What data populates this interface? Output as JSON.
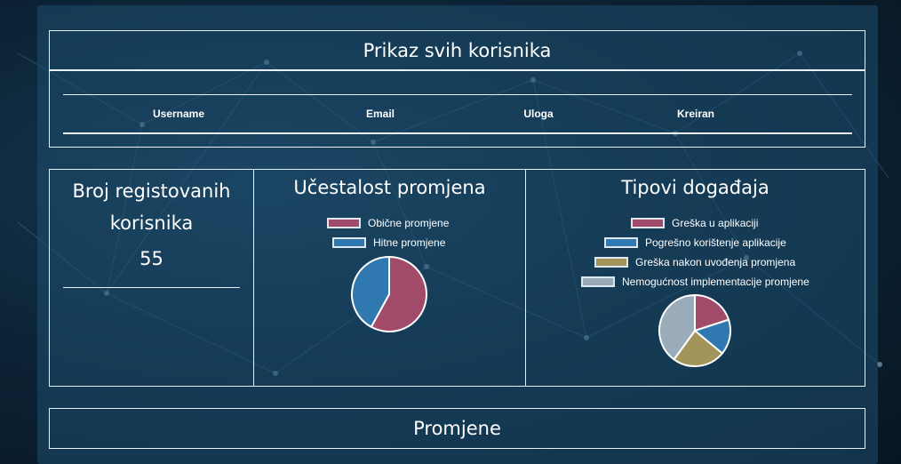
{
  "users_section": {
    "title": "Prikaz svih korisnika",
    "columns": [
      "Username",
      "Email",
      "Uloga",
      "Kreiran"
    ]
  },
  "registered": {
    "title_line1": "Broj registovanih",
    "title_line2": "korisnika",
    "count": "55"
  },
  "changes_frequency": {
    "title": "Učestalost promjena",
    "legend": [
      {
        "label": "Obične promjene",
        "color": "#a14a6a"
      },
      {
        "label": "Hitne promjene",
        "color": "#2f78b0"
      }
    ]
  },
  "event_types": {
    "title": "Tipovi događaja",
    "legend": [
      {
        "label": "Greška u aplikaciji",
        "color": "#a14a6a"
      },
      {
        "label": "Pogrešno korištenje aplikacije",
        "color": "#2f78b0"
      },
      {
        "label": "Greška nakon uvođenja promjena",
        "color": "#a3955a"
      },
      {
        "label": "Nemogućnost implementacije promjene",
        "color": "#9aabba"
      }
    ]
  },
  "changes_section": {
    "title": "Promjene"
  },
  "chart_data": [
    {
      "type": "pie",
      "title": "Učestalost promjena",
      "categories": [
        "Obične promjene",
        "Hitne promjene"
      ],
      "values": [
        58,
        42
      ],
      "colors": [
        "#a14a6a",
        "#2f78b0"
      ]
    },
    {
      "type": "pie",
      "title": "Tipovi događaja",
      "categories": [
        "Greška u aplikaciji",
        "Pogrešno korištenje aplikacije",
        "Greška nakon uvođenja promjena",
        "Nemogućnost implementacije promjene"
      ],
      "values": [
        20,
        16,
        24,
        40
      ],
      "colors": [
        "#a14a6a",
        "#2f78b0",
        "#a3955a",
        "#9aabba"
      ]
    }
  ]
}
